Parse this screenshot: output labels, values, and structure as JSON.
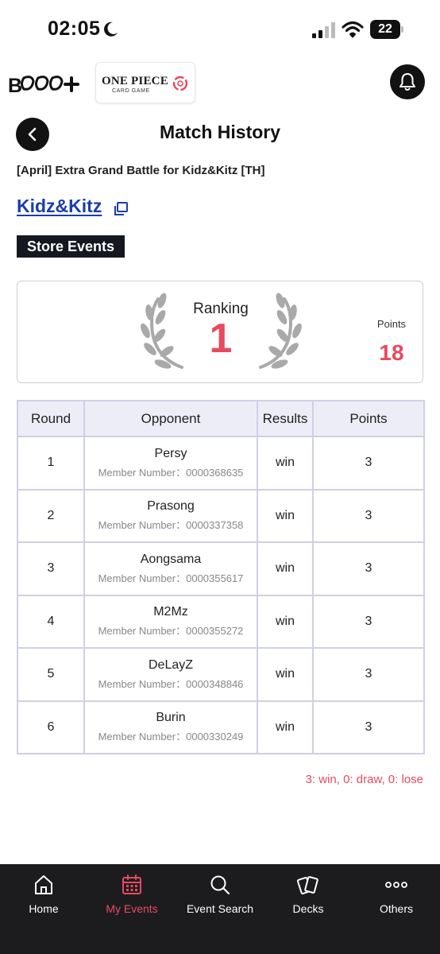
{
  "status_bar": {
    "time": "02:05",
    "battery": "22"
  },
  "header": {
    "brand": "BCG+",
    "game_logo_title": "ONE PIECE",
    "game_logo_subtitle": "CARD GAME"
  },
  "page": {
    "title": "Match History",
    "event_name": "[April] Extra Grand Battle for Kidz&Kitz [TH]",
    "store_name": "Kidz&Kitz",
    "event_type": "Store Events"
  },
  "ranking": {
    "label": "Ranking",
    "value": "1",
    "points_label": "Points",
    "points_value": "18"
  },
  "table": {
    "headers": [
      "Round",
      "Opponent",
      "Results",
      "Points"
    ],
    "member_prefix": "Member Number：",
    "rows": [
      {
        "round": "1",
        "opponent": "Persy",
        "member": "Member Number：0000368635",
        "result": "win",
        "points": "3"
      },
      {
        "round": "2",
        "opponent": "Prasong",
        "member": "Member Number：0000337358",
        "result": "win",
        "points": "3"
      },
      {
        "round": "3",
        "opponent": "Aongsama",
        "member": "Member Number：0000355617",
        "result": "win",
        "points": "3"
      },
      {
        "round": "4",
        "opponent": "M2Mz",
        "member": "Member Number：0000355272",
        "result": "win",
        "points": "3"
      },
      {
        "round": "5",
        "opponent": "DeLayZ",
        "member": "Member Number：0000348846",
        "result": "win",
        "points": "3"
      },
      {
        "round": "6",
        "opponent": "Burin",
        "member": "Member Number：0000330249",
        "result": "win",
        "points": "3"
      }
    ]
  },
  "legend": "3: win, 0: draw, 0: lose",
  "colors": {
    "accent": "#e84a5f",
    "link": "#1a3ea8",
    "nav_bg": "#1c1c1f",
    "table_header_bg": "#ecedf7"
  },
  "nav": {
    "active": "My Events",
    "items": [
      {
        "label": "Home",
        "icon": "home-icon"
      },
      {
        "label": "My Events",
        "icon": "calendar-icon"
      },
      {
        "label": "Event Search",
        "icon": "search-icon"
      },
      {
        "label": "Decks",
        "icon": "cards-icon"
      },
      {
        "label": "Others",
        "icon": "more-icon"
      }
    ]
  }
}
